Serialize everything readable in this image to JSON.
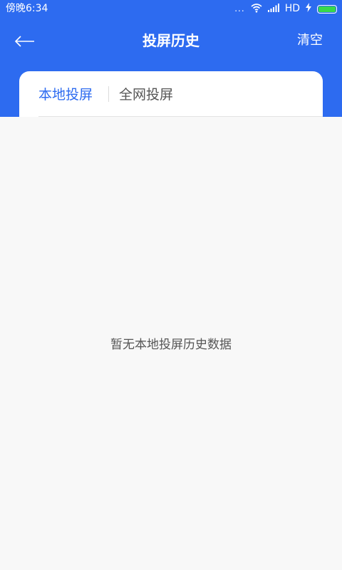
{
  "status_bar": {
    "time": "傍晚6:34",
    "dots": "...",
    "network": "HD",
    "battery_level": 1.0,
    "battery_color": "#39d94a",
    "icons": [
      "wifi-icon",
      "signal-icon",
      "charging-icon",
      "battery-icon"
    ]
  },
  "header": {
    "title": "投屏历史",
    "clear_label": "清空",
    "back_icon": "back-arrow-icon",
    "background": "#2d6bf0"
  },
  "tabs": [
    {
      "label": "本地投屏",
      "active": true
    },
    {
      "label": "全网投屏",
      "active": false
    }
  ],
  "content": {
    "empty_message": "暂无本地投屏历史数据"
  },
  "colors": {
    "accent": "#2d6bf0",
    "page_background": "#f8f8f8",
    "inactive_text": "#555555"
  }
}
